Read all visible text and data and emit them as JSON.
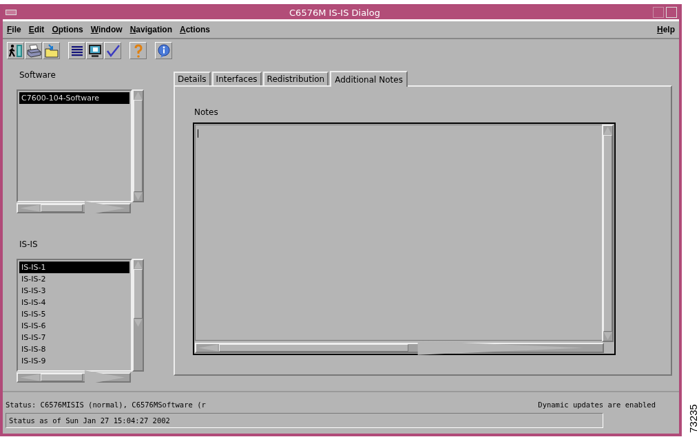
{
  "window": {
    "title": "C6576M IS-IS Dialog"
  },
  "menu": [
    {
      "label": "File"
    },
    {
      "label": "Edit"
    },
    {
      "label": "Options"
    },
    {
      "label": "Window"
    },
    {
      "label": "Navigation"
    },
    {
      "label": "Actions"
    }
  ],
  "help_menu": {
    "label": "Help"
  },
  "software": {
    "label": "Software",
    "items": [
      {
        "text": "C7600-104-Software",
        "selected": true
      }
    ]
  },
  "isis": {
    "label": "IS-IS",
    "items": [
      {
        "text": "IS-IS-1",
        "selected": true
      },
      {
        "text": "IS-IS-2",
        "selected": false
      },
      {
        "text": "IS-IS-3",
        "selected": false
      },
      {
        "text": "IS-IS-4",
        "selected": false
      },
      {
        "text": "IS-IS-5",
        "selected": false
      },
      {
        "text": "IS-IS-6",
        "selected": false
      },
      {
        "text": "IS-IS-7",
        "selected": false
      },
      {
        "text": "IS-IS-8",
        "selected": false
      },
      {
        "text": "IS-IS-9",
        "selected": false
      }
    ]
  },
  "tabs": [
    {
      "label": "Details",
      "selected": false
    },
    {
      "label": "Interfaces",
      "selected": false
    },
    {
      "label": "Redistribution",
      "selected": false
    },
    {
      "label": "Additional Notes",
      "selected": true
    }
  ],
  "notes": {
    "label": "Notes"
  },
  "status_bar": {
    "status": "Status: C6576MISIS (normal), C6576MSoftware (r",
    "updates": "Dynamic updates are enabled",
    "timestamp": "Status as of Sun Jan 27 15:04:27 2002"
  },
  "figure_number": "73235"
}
